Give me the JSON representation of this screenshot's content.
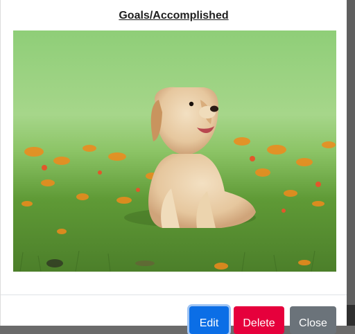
{
  "modal": {
    "title": "Goals/Accomplished",
    "image_subject": "golden retriever puppy sitting in grass with orange flowers"
  },
  "footer": {
    "edit_label": "Edit",
    "delete_label": "Delete",
    "close_label": "Close"
  },
  "colors": {
    "edit_button": "#0b6ee6",
    "delete_button": "#e6003c",
    "close_button": "#6b737a"
  }
}
